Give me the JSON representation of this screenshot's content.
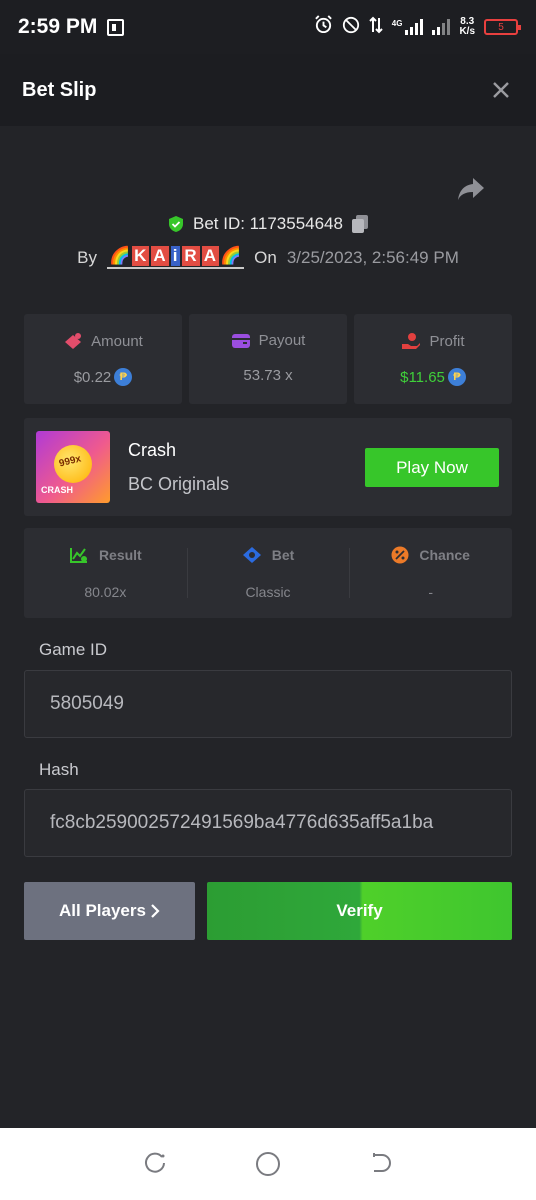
{
  "status": {
    "time": "2:59 PM",
    "network": "4G",
    "speed_value": "8.3",
    "speed_unit": "K/s",
    "battery": "5",
    "battery_color": "#e8403f"
  },
  "header": {
    "title": "Bet Slip"
  },
  "bet": {
    "id_label": "Bet ID: 1173554648",
    "by_label": "By",
    "on_label": "On",
    "date": "3/25/2023, 2:56:49 PM",
    "username_parts": [
      "K",
      "A",
      "i",
      "R",
      "A"
    ]
  },
  "stats": [
    {
      "label": "Amount",
      "value": "$0.22",
      "icon": "money-icon",
      "color": "#e24d6b"
    },
    {
      "label": "Payout",
      "value": "53.73 x",
      "icon": "wallet-icon",
      "color": "#9b4ee0"
    },
    {
      "label": "Profit",
      "value": "$11.65",
      "icon": "profit-hand-icon",
      "color": "#e2403f"
    }
  ],
  "coin_symbol": "₱",
  "game": {
    "thumb_multiplier": "999x",
    "thumb_label": "CRASH",
    "name": "Crash",
    "provider": "BC Originals",
    "play_label": "Play Now",
    "accent": "#37c62a"
  },
  "result": [
    {
      "label": "Result",
      "value": "80.02x",
      "icon": "chart-check-icon"
    },
    {
      "label": "Bet",
      "value": "Classic",
      "icon": "bet-diamond-icon"
    },
    {
      "label": "Chance",
      "value": "-",
      "icon": "percent-icon"
    }
  ],
  "fields": {
    "game_id_label": "Game ID",
    "game_id_value": "5805049",
    "hash_label": "Hash",
    "hash_value": "fc8cb259002572491569ba4776d635aff5a1ba"
  },
  "buttons": {
    "all_players": "All Players",
    "verify": "Verify"
  }
}
